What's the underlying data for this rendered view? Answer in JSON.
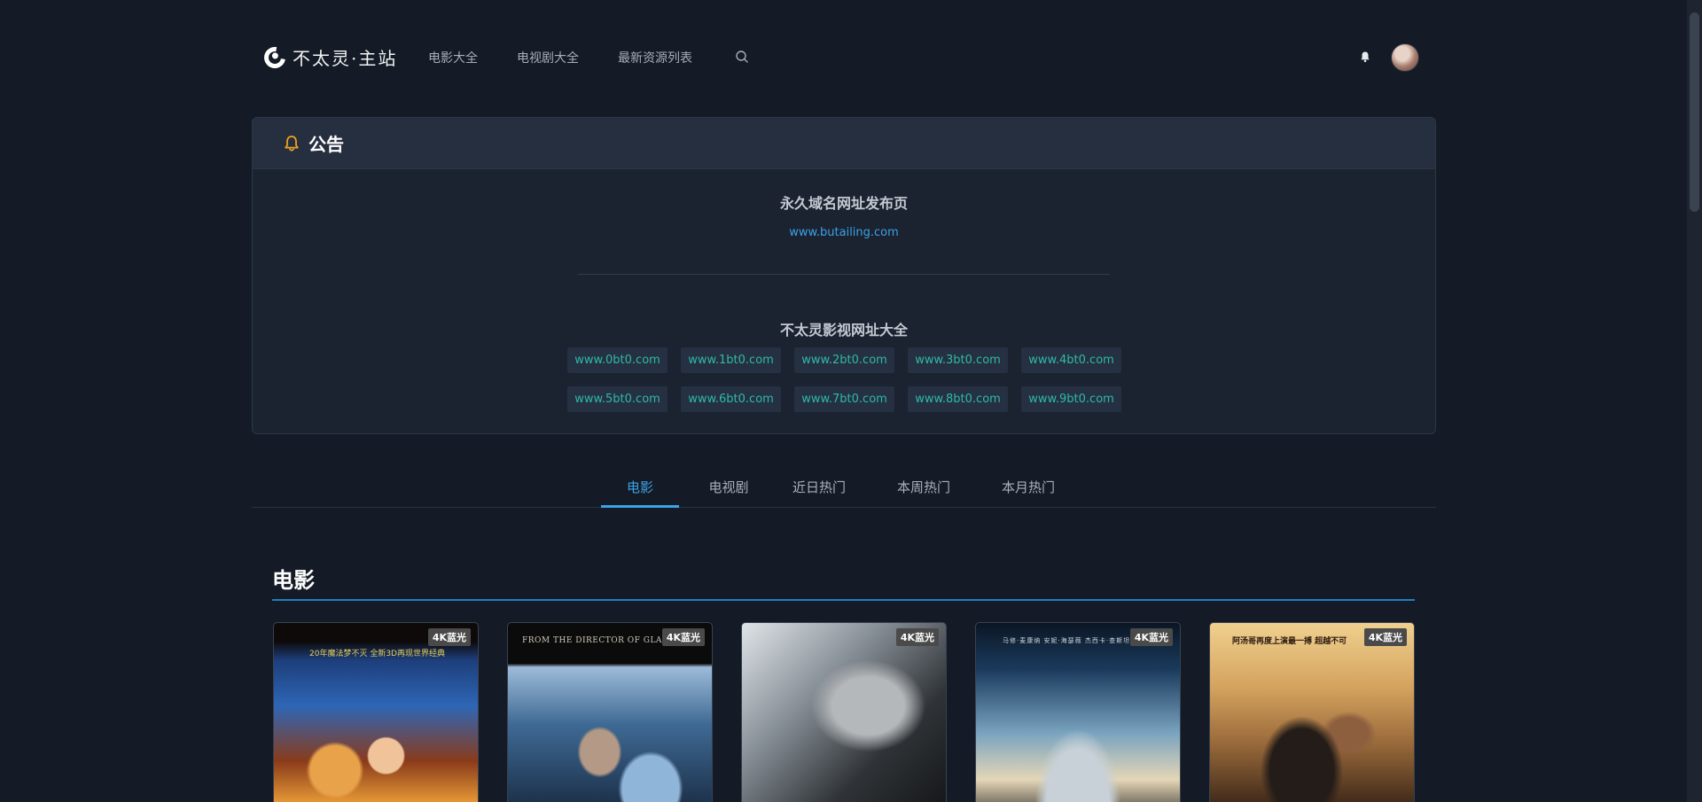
{
  "header": {
    "logo_text": "不太灵·主站",
    "nav": [
      "电影大全",
      "电视剧大全",
      "最新资源列表"
    ],
    "search_icon": "search-icon",
    "notification_icon": "bell-icon"
  },
  "notice": {
    "title": "公告",
    "icon": "bell-icon",
    "permanent_title": "永久域名网址发布页",
    "permanent_url": "www.butailing.com",
    "mirrors_title": "不太灵影视网址大全",
    "mirrors": [
      "www.0bt0.com",
      "www.1bt0.com",
      "www.2bt0.com",
      "www.3bt0.com",
      "www.4bt0.com",
      "www.5bt0.com",
      "www.6bt0.com",
      "www.7bt0.com",
      "www.8bt0.com",
      "www.9bt0.com"
    ]
  },
  "tabs": [
    "电影",
    "电视剧",
    "近日热门",
    "本周热门",
    "本月热门"
  ],
  "active_tab": "电影",
  "section": {
    "title": "电影",
    "posters": [
      {
        "badge": "4K蓝光",
        "tagline": "20年魔法梦不灭 全新3D再现世界经典"
      },
      {
        "badge": "4K蓝光",
        "tagline": "FROM THE DIRECTOR OF GLAD"
      },
      {
        "badge": "4K蓝光",
        "tagline": ""
      },
      {
        "badge": "4K蓝光",
        "tagline": "马修·麦康纳 安妮·海瑟薇 杰西卡·查斯坦 迈克"
      },
      {
        "badge": "4K蓝光",
        "tagline": "阿汤哥再度上演最一搏 超越不可"
      }
    ]
  },
  "colors": {
    "background": "#141b26",
    "accent": "#3ba2e8",
    "chip_text": "#2fb9a8",
    "bell": "#f0a11e"
  }
}
